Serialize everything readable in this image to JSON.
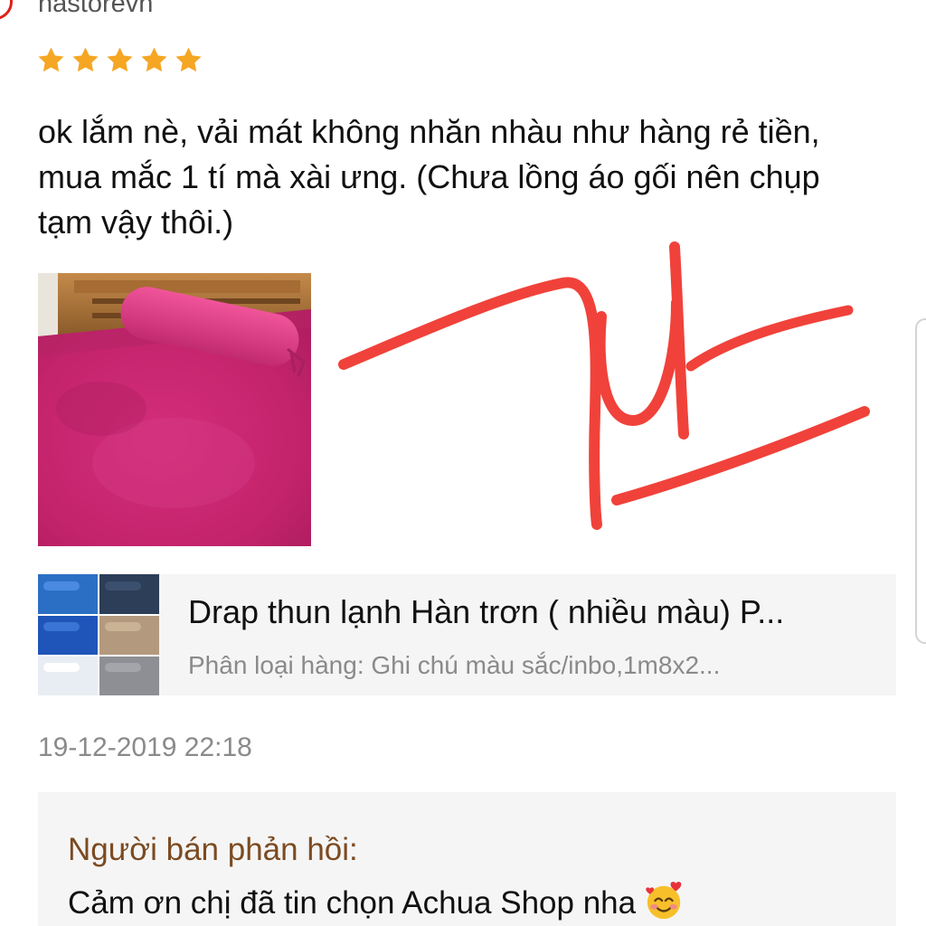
{
  "review": {
    "username": "nastorevn",
    "rating": 5,
    "rating_max": 5,
    "text": "ok lắm nè, vải mát không nhăn nhàu như hàng rẻ tiền, mua mắc 1 tí mà xài ưng. (Chưa lồng áo gối nên chụp tạm vậy thôi.)",
    "timestamp": "19-12-2019 22:18"
  },
  "product": {
    "name": "Drap thun lạnh Hàn trơn ( nhiều màu) P...",
    "variant": "Phân loại hàng: Ghi chú màu sắc/inbo,1m8x2..."
  },
  "seller_reply": {
    "label": "Người bán phản hồi:",
    "text": "Cảm ơn chị đã tin chọn Achua Shop nha"
  },
  "colors": {
    "star": "#f5a623",
    "signature": "#f0423a",
    "reply_label": "#7b4b22",
    "card_bg": "#f5f5f5"
  },
  "icons": {
    "rating": "star-icon",
    "reply_emoji": "smiling-face-with-hearts-icon"
  }
}
